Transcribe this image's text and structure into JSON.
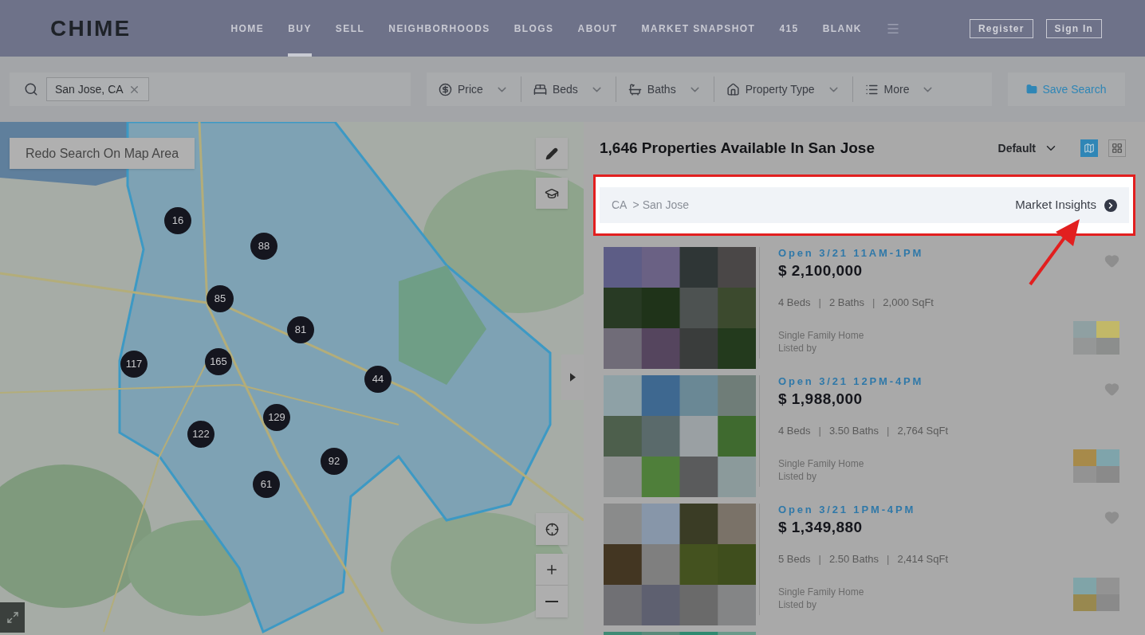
{
  "header": {
    "logo": "CHIME",
    "nav": [
      {
        "label": "HOME",
        "selected": false
      },
      {
        "label": "BUY",
        "selected": true
      },
      {
        "label": "SELL",
        "selected": false
      },
      {
        "label": "NEIGHBORHOODS",
        "selected": false
      },
      {
        "label": "BLOGS",
        "selected": false
      },
      {
        "label": "ABOUT",
        "selected": false
      },
      {
        "label": "MARKET SNAPSHOT",
        "selected": false
      },
      {
        "label": "415",
        "selected": false
      },
      {
        "label": "BLANK",
        "selected": false
      }
    ],
    "buttons": [
      "Register",
      "Sign In"
    ]
  },
  "search": {
    "chip": "San Jose, CA"
  },
  "filters": [
    {
      "kind": "price",
      "label": "Price"
    },
    {
      "kind": "beds",
      "label": "Beds"
    },
    {
      "kind": "baths",
      "label": "Baths"
    },
    {
      "kind": "type",
      "label": "Property Type"
    },
    {
      "kind": "more",
      "label": "More"
    }
  ],
  "save_search": "Save Search",
  "map": {
    "redo_button": "Redo Search On Map Area",
    "markers": [
      "16",
      "88",
      "85",
      "81",
      "117",
      "165",
      "44",
      "129",
      "122",
      "92",
      "61"
    ]
  },
  "results": {
    "title": "1,646 Properties Available In San Jose",
    "sort": "Default",
    "views": [
      {
        "kind": "map",
        "selected": true
      },
      {
        "kind": "grid",
        "selected": false
      }
    ]
  },
  "insights": {
    "breadcrumb": [
      "CA",
      "San Jose"
    ],
    "separator": ">",
    "link": "Market Insights"
  },
  "listings": [
    {
      "open": "Open 3/21 11AM-1PM",
      "price": "$ 2,100,000",
      "beds": "4 Beds",
      "baths": "2 Baths",
      "sqft": "2,000 SqFt",
      "type": "Single Family Home",
      "listed_by": "Listed by",
      "separator": "|"
    },
    {
      "open": "Open 3/21 12PM-4PM",
      "price": "$ 1,988,000",
      "beds": "4 Beds",
      "baths": "3.50 Baths",
      "sqft": "2,764 SqFt",
      "type": "Single Family Home",
      "listed_by": "Listed by",
      "separator": "|"
    },
    {
      "open": "Open 3/21 1PM-4PM",
      "price": "$ 1,349,880",
      "beds": "5 Beds",
      "baths": "2.50 Baths",
      "sqft": "2,414 SqFt",
      "type": "Single Family Home",
      "listed_by": "Listed by",
      "separator": "|"
    },
    {
      "kind": "picture"
    }
  ]
}
